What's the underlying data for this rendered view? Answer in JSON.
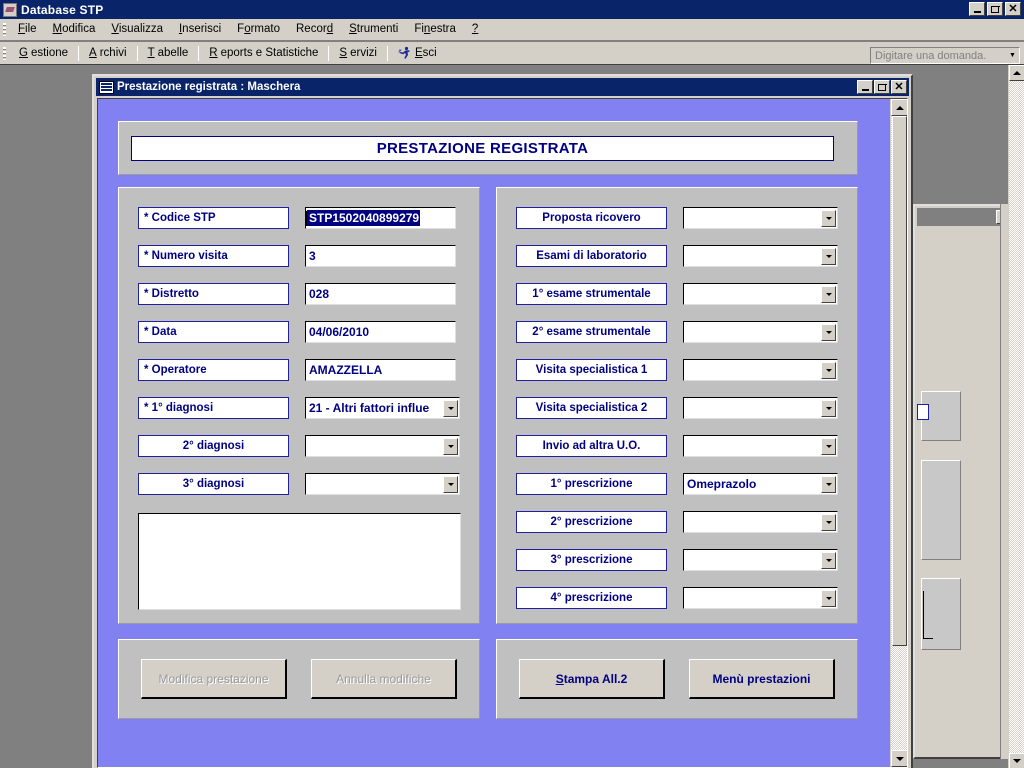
{
  "app": {
    "title": "Database STP",
    "icon": "access-database-icon",
    "window_buttons": [
      "minimize",
      "restore",
      "close"
    ]
  },
  "menubar": [
    {
      "label": "File",
      "accel": "F"
    },
    {
      "label": "Modifica",
      "accel": "M"
    },
    {
      "label": "Visualizza",
      "accel": "V"
    },
    {
      "label": "Inserisci",
      "accel": "I"
    },
    {
      "label": "Formato",
      "accel": "o"
    },
    {
      "label": "Record",
      "accel": "d"
    },
    {
      "label": "Strumenti",
      "accel": "S"
    },
    {
      "label": "Finestra",
      "accel": "n"
    },
    {
      "label": "?",
      "accel": "?"
    }
  ],
  "toolbar": {
    "items": [
      {
        "label": "Gestione",
        "accel": "G",
        "icon": null
      },
      {
        "label": "Archivi",
        "accel": "A",
        "icon": null
      },
      {
        "label": "Tabelle",
        "accel": "T",
        "icon": null
      },
      {
        "label": "Reports e Statistiche",
        "accel": "R",
        "icon": null
      },
      {
        "label": "Servizi",
        "accel": "S",
        "icon": null
      },
      {
        "label": "Esci",
        "accel": "E",
        "icon": "running-man-icon"
      }
    ],
    "ask_box": {
      "placeholder": "Digitare una domanda.",
      "value": "Digitare una domanda."
    }
  },
  "form_window": {
    "title": "Prestazione registrata : Maschera",
    "icon": "form-icon",
    "window_buttons": [
      "minimize",
      "restore",
      "close"
    ]
  },
  "banner": {
    "title": "PRESTAZIONE REGISTRATA"
  },
  "left_panel": {
    "rows": [
      {
        "label": "* Codice STP",
        "type": "text",
        "value": "STP1502040899279",
        "selected": true
      },
      {
        "label": "* Numero visita",
        "type": "text",
        "value": "3"
      },
      {
        "label": "* Distretto",
        "type": "text",
        "value": "028"
      },
      {
        "label": "* Data",
        "type": "text",
        "value": "04/06/2010"
      },
      {
        "label": "* Operatore",
        "type": "text",
        "value": "AMAZZELLA"
      },
      {
        "label": "* 1° diagnosi",
        "type": "combo",
        "value": "21 - Altri fattori influe"
      },
      {
        "label": "2° diagnosi",
        "type": "combo",
        "value": "",
        "center": true
      },
      {
        "label": "3° diagnosi",
        "type": "combo",
        "value": "",
        "center": true
      }
    ],
    "memo": {
      "value": ""
    }
  },
  "right_panel": {
    "rows": [
      {
        "label": "Proposta ricovero",
        "type": "combo",
        "value": "",
        "center": true
      },
      {
        "label": "Esami di laboratorio",
        "type": "combo",
        "value": "",
        "center": true
      },
      {
        "label": "1° esame strumentale",
        "type": "combo",
        "value": "",
        "center": true
      },
      {
        "label": "2° esame strumentale",
        "type": "combo",
        "value": "",
        "center": true
      },
      {
        "label": "Visita specialistica 1",
        "type": "combo",
        "value": "",
        "center": true
      },
      {
        "label": "Visita specialistica 2",
        "type": "combo",
        "value": "",
        "center": true
      },
      {
        "label": "Invio ad altra U.O.",
        "type": "combo",
        "value": "",
        "center": true
      },
      {
        "label": "1° prescrizione",
        "type": "combo",
        "value": "Omeprazolo",
        "center": true
      },
      {
        "label": "2° prescrizione",
        "type": "combo",
        "value": "",
        "center": true
      },
      {
        "label": "3° prescrizione",
        "type": "combo",
        "value": "",
        "center": true
      },
      {
        "label": "4° prescrizione",
        "type": "combo",
        "value": "",
        "center": true
      }
    ]
  },
  "buttons": {
    "left": [
      {
        "label": "Modifica prestazione",
        "enabled": false
      },
      {
        "label": "Annulla modifiche",
        "enabled": false
      }
    ],
    "right": [
      {
        "label": "Stampa All.2",
        "enabled": true,
        "accel": "S"
      },
      {
        "label": "Menù prestazioni",
        "enabled": true,
        "accel": null
      }
    ]
  },
  "background_window": {
    "title": "",
    "close_label": "✕"
  },
  "colors": {
    "titlebar": "#0a246a",
    "form_background": "#8181f2",
    "panel": "#c0c0c0",
    "label_text": "#000080",
    "mdi_background": "#808080",
    "chrome": "#d4d0c8",
    "selection": "#000080"
  }
}
